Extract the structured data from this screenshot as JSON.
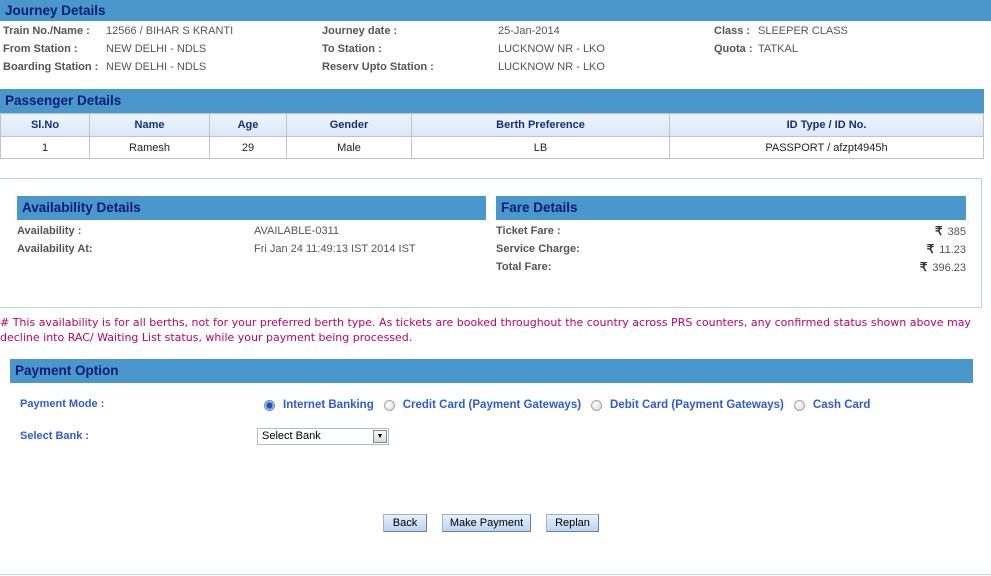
{
  "journey": {
    "title": "Journey Details",
    "fields": [
      {
        "label": "Train No./Name :",
        "value": "12566 / BIHAR S KRANTI"
      },
      {
        "label": "From Station :",
        "value": "NEW DELHI - NDLS"
      },
      {
        "label": "Boarding Station :",
        "value": "NEW DELHI - NDLS"
      },
      {
        "label": "Journey date :",
        "value": "25-Jan-2014"
      },
      {
        "label": "To Station :",
        "value": "LUCKNOW NR - LKO"
      },
      {
        "label": "Reserv Upto Station :",
        "value": "LUCKNOW NR - LKO"
      },
      {
        "label": "Class :",
        "value": "SLEEPER CLASS"
      },
      {
        "label": "Quota :",
        "value": "TATKAL"
      }
    ]
  },
  "passengers": {
    "title": "Passenger Details",
    "columns": [
      "Sl.No",
      "Name",
      "Age",
      "Gender",
      "Berth Preference",
      "ID Type / ID No."
    ],
    "rows": [
      [
        "1",
        "Ramesh",
        "29",
        "Male",
        "LB",
        "PASSPORT / afzpt4945h"
      ]
    ]
  },
  "availability": {
    "title": "Availability Details",
    "fields": [
      {
        "label": "Availability :",
        "value": "AVAILABLE-0311"
      },
      {
        "label": "Availability At:",
        "value": "Fri Jan 24 11:49:13 IST 2014 IST"
      }
    ]
  },
  "fare": {
    "title": "Fare Details",
    "currency_symbol": "₹",
    "fields": [
      {
        "label": "Ticket Fare :",
        "value": "385"
      },
      {
        "label": "Service Charge:",
        "value": "11.23"
      },
      {
        "label": "Total Fare:",
        "value": "396.23"
      }
    ]
  },
  "note": "# This availability is for all berths, not for your preferred berth type. As tickets are booked throughout the country across PRS counters, any confirmed status shown above may decline into RAC/ Waiting List status, while your payment being processed.",
  "payment": {
    "title": "Payment Option",
    "mode_label": "Payment Mode :",
    "modes": [
      {
        "label": "Internet Banking",
        "selected": true
      },
      {
        "label": "Credit Card (Payment Gateways)",
        "selected": false
      },
      {
        "label": "Debit Card (Payment Gateways)",
        "selected": false
      },
      {
        "label": "Cash Card",
        "selected": false
      }
    ],
    "bank_label": "Select Bank :",
    "bank_selected": "Select Bank"
  },
  "buttons": {
    "back": "Back",
    "make_payment": "Make Payment",
    "replan": "Replan"
  },
  "colors": {
    "header_bar": "#4a98cb",
    "header_text": "#0a1a7a",
    "note_text": "#c0006a",
    "payment_label": "#2e5bd9"
  }
}
